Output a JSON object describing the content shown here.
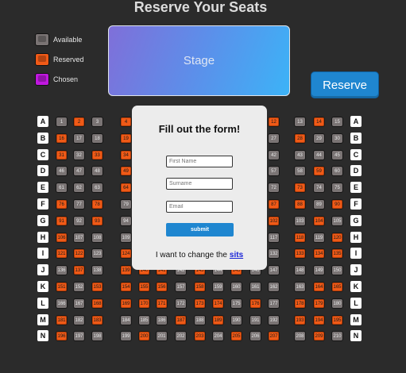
{
  "title": "Reserve Your Seats",
  "legend": [
    {
      "label": "Available",
      "color": "#7a7474"
    },
    {
      "label": "Reserved",
      "color": "#f05a17"
    },
    {
      "label": "Chosen",
      "color": "#c018e0"
    }
  ],
  "stage_label": "Stage",
  "reserve_button": "Reserve",
  "rows": [
    "A",
    "B",
    "C",
    "D",
    "E",
    "F",
    "G",
    "H",
    "I",
    "J",
    "K",
    "L",
    "M",
    "N"
  ],
  "reserved_seats": [
    2,
    4,
    8,
    10,
    12,
    14,
    16,
    19,
    20,
    24,
    28,
    31,
    33,
    34,
    35,
    37,
    39,
    40,
    49,
    51,
    53,
    59,
    64,
    66,
    69,
    71,
    73,
    76,
    78,
    82,
    83,
    85,
    87,
    88,
    90,
    91,
    93,
    96,
    98,
    101,
    102,
    104,
    106,
    111,
    118,
    120,
    121,
    122,
    124,
    125,
    128,
    131,
    133,
    134,
    135,
    137,
    139,
    140,
    141,
    143,
    145,
    151,
    153,
    154,
    155,
    156,
    158,
    164,
    165,
    168,
    169,
    170,
    171,
    173,
    174,
    176,
    178,
    179,
    181,
    183,
    187,
    189,
    193,
    194,
    195,
    196,
    200,
    203,
    205,
    207,
    209
  ],
  "form": {
    "title": "Fill out the form!",
    "first_name_placeholder": "First Name",
    "surname_placeholder": "Surname",
    "email_placeholder": "Email",
    "submit": "submit",
    "change_text": "I want to change the",
    "change_link": "sits"
  }
}
